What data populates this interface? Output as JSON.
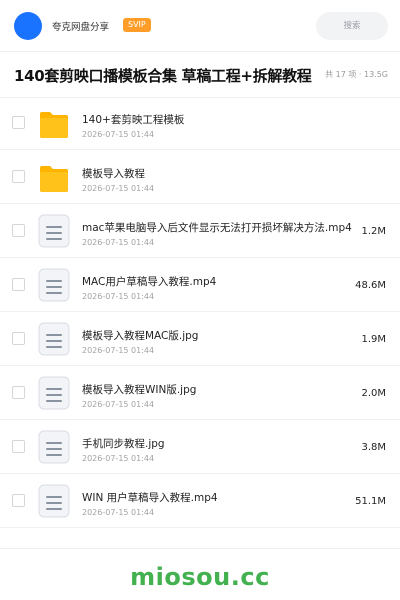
{
  "header": {
    "share_title": "夸克网盘分享",
    "badge": "SVIP",
    "search_placeholder": "搜索"
  },
  "share": {
    "title": "140套剪映口播模板合集 草稿工程+拆解教程",
    "meta": "共 17 项 · 13.5G"
  },
  "files": [
    {
      "name": "140+套剪映工程模板",
      "date": "2026-07-15 01:44",
      "size": "",
      "icon": "folder-icon"
    },
    {
      "name": "模板导入教程",
      "date": "2026-07-15 01:44",
      "size": "",
      "icon": "folder-icon"
    },
    {
      "name": "mac苹果电脑导入后文件显示无法打开损坏解决方法.mp4",
      "date": "2026-07-15 01:44",
      "size": "1.2M",
      "icon": "file-icon"
    },
    {
      "name": "MAC用户草稿导入教程.mp4",
      "date": "2026-07-15 01:44",
      "size": "48.6M",
      "icon": "file-icon"
    },
    {
      "name": "模板导入教程MAC版.jpg",
      "date": "2026-07-15 01:44",
      "size": "1.9M",
      "icon": "file-icon"
    },
    {
      "name": "模板导入教程WIN版.jpg",
      "date": "2026-07-15 01:44",
      "size": "2.0M",
      "icon": "file-icon"
    },
    {
      "name": "手机同步教程.jpg",
      "date": "2026-07-15 01:44",
      "size": "3.8M",
      "icon": "file-icon"
    },
    {
      "name": "WIN 用户草稿导入教程.mp4",
      "date": "2026-07-15 01:44",
      "size": "51.1M",
      "icon": "file-icon"
    }
  ],
  "footer": {
    "watermark": "miosou.cc"
  },
  "colors": {
    "accent_blue": "#1a73ff",
    "svip_orange": "#ff9d28",
    "folder_yellow": "#ffc21a",
    "watermark_green": "#43b14f"
  }
}
